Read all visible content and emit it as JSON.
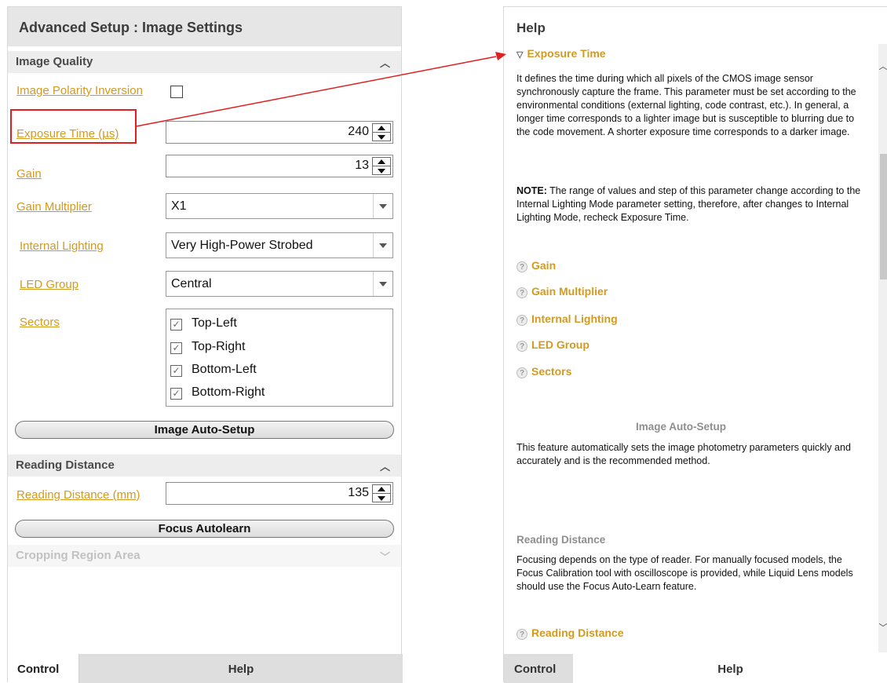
{
  "left_panel": {
    "title": "Advanced Setup : Image Settings",
    "image_quality": {
      "header": "Image Quality",
      "polarity_label": "Image Polarity Inversion",
      "exposure_label": "Exposure Time (µs)",
      "exposure_value": "240",
      "gain_label": "Gain",
      "gain_value": "13",
      "gain_multiplier_label": "Gain Multiplier",
      "gain_multiplier_value": "X1",
      "internal_lighting_label": "Internal Lighting",
      "internal_lighting_value": "Very High-Power Strobed",
      "led_group_label": "LED Group",
      "led_group_value": "Central",
      "sectors_label": "Sectors",
      "sectors": [
        "Top-Left",
        "Top-Right",
        "Bottom-Left",
        "Bottom-Right"
      ],
      "auto_setup_button": "Image Auto-Setup"
    },
    "reading_distance": {
      "header": "Reading Distance",
      "label": "Reading Distance (mm)",
      "value": "135",
      "focus_button": "Focus Autolearn"
    },
    "cropping": {
      "header": "Cropping Region Area"
    },
    "tabs": {
      "control": "Control",
      "help": "Help"
    }
  },
  "right_panel": {
    "title": "Help",
    "expanded_topic": "Exposure Time",
    "exposure_description": "It defines the time during which all pixels of the CMOS image sensor synchronously capture the frame. This parameter must be set according to the environmental conditions (external lighting, code contrast, etc.). In general, a longer time corresponds to a lighter image but is susceptible to blurring due to the code movement. A shorter exposure time corresponds to a darker image.",
    "note_label": "NOTE:",
    "note_text": " The range of values and step of this parameter change according to the Internal Lighting Mode parameter setting, therefore, after changes to Internal Lighting Mode, recheck Exposure Time.",
    "links": [
      "Gain",
      "Gain Multiplier",
      "Internal Lighting",
      "LED Group",
      "Sectors"
    ],
    "auto_setup_heading": "Image Auto-Setup",
    "auto_setup_text": "This feature automatically sets the image photometry parameters quickly and accurately and is the recommended method.",
    "reading_distance_heading": "Reading Distance",
    "reading_distance_text": "Focusing depends on the type of reader. For manually focused models, the Focus Calibration tool with oscilloscope is provided, while Liquid Lens models should use the Focus Auto-Learn feature.",
    "reading_distance_link": "Reading Distance",
    "tabs": {
      "control": "Control",
      "help": "Help"
    }
  },
  "colors": {
    "link": "#d39a1f",
    "highlight_box": "#e02020",
    "arrow": "#e02020"
  }
}
